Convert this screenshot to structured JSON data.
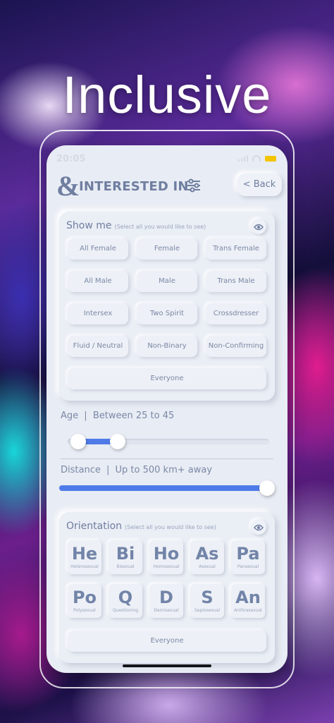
{
  "headline": "Inclusive",
  "status": {
    "time": "20:05"
  },
  "header": {
    "logo": "&",
    "title": "INTERESTED IN",
    "back_label": "< Back"
  },
  "show_me": {
    "title": "Show me",
    "hint": "(Select all you would like to see)",
    "options": [
      "All Female",
      "Female",
      "Trans Female",
      "All Male",
      "Male",
      "Trans Male",
      "Intersex",
      "Two Spirit",
      "Crossdresser",
      "Fluid / Neutral",
      "Non-Binary",
      "Non-Confirming"
    ],
    "everyone": "Everyone"
  },
  "age": {
    "label": "Age",
    "separator": "|",
    "value": "Between 25 to 45"
  },
  "distance": {
    "label": "Distance",
    "separator": "|",
    "value": "Up to 500 km+ away"
  },
  "orientation": {
    "title": "Orientation",
    "hint": "(Select all you would like to see)",
    "tiles": [
      {
        "symbol": "He",
        "name": "Heterosexual"
      },
      {
        "symbol": "Bi",
        "name": "Bisexual"
      },
      {
        "symbol": "Ho",
        "name": "Homosexual"
      },
      {
        "symbol": "As",
        "name": "Asexual"
      },
      {
        "symbol": "Pa",
        "name": "Pansexual"
      },
      {
        "symbol": "Po",
        "name": "Polysexual"
      },
      {
        "symbol": "Q",
        "name": "Questioning"
      },
      {
        "symbol": "D",
        "name": "Demisexual"
      },
      {
        "symbol": "S",
        "name": "Sapiosexual"
      },
      {
        "symbol": "An",
        "name": "Anthrasexual"
      }
    ],
    "everyone": "Everyone"
  },
  "colors": {
    "accent": "#4f7be8",
    "text": "#6f7ea0",
    "surface": "#e8ecf4",
    "battery": "#f5c400"
  }
}
